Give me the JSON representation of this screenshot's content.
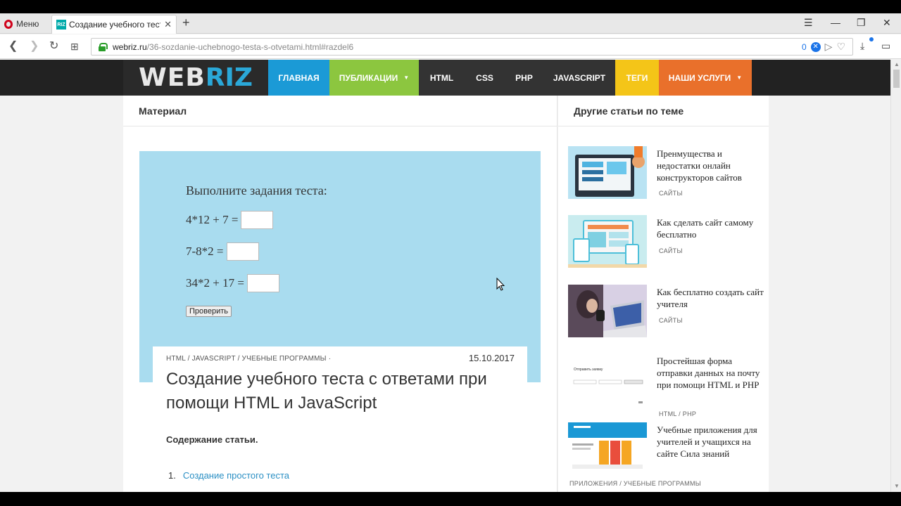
{
  "browser": {
    "menu_label": "Меню",
    "tab_title": "Создание учебного теста",
    "favicon_text": "RIZ",
    "url_host": "webriz.ru",
    "url_path": "/36-sozdanie-uchebnogo-testa-s-otvetami.html#razdel6",
    "adblock_count": "0"
  },
  "nav": {
    "logo_web": "WEB",
    "logo_riz": "RIZ",
    "items": [
      {
        "label": "ГЛАВНАЯ",
        "color": "#1b9ad6"
      },
      {
        "label": "ПУБЛИКАЦИИ",
        "color": "#8cc63f"
      },
      {
        "label": "HTML",
        "color": "#333333"
      },
      {
        "label": "CSS",
        "color": "#333333"
      },
      {
        "label": "PHP",
        "color": "#333333"
      },
      {
        "label": "JAVASCRIPT",
        "color": "#333333"
      },
      {
        "label": "ТЕГИ",
        "color": "#f4c518"
      },
      {
        "label": "НАШИ УСЛУГИ",
        "color": "#e9702b"
      }
    ]
  },
  "main": {
    "header": "Материал",
    "hero": {
      "title": "Выполните задания теста:",
      "questions": [
        "4*12 + 7 =",
        "7-8*2 =",
        "34*2 + 17 ="
      ],
      "check_button": "Проверить"
    },
    "article": {
      "cat1": "HTML",
      "cat2": "JAVASCRIPT",
      "cat3": "УЧЕБНЫЕ ПРОГРАММЫ",
      "date": "15.10.2017",
      "title": "Создание учебного теста с ответами при помощи HTML и JavaScript",
      "toc_label": "Содержание статьи.",
      "toc": [
        {
          "num": "1.",
          "label": "Создание простого теста"
        }
      ]
    }
  },
  "sidebar": {
    "header": "Другие статьи по теме",
    "items": [
      {
        "title": "Пренмущества и недостатки онлайн конструкторов сайтов",
        "category": "САЙТЫ"
      },
      {
        "title": "Как сделать сайт самому бесплатно",
        "category": "САЙТЫ"
      },
      {
        "title": "Как бесплатно создать сайт учителя",
        "category": "САЙТЫ"
      },
      {
        "title": "Простейшая форма отправки данных на почту при помощи HTML и PHP",
        "category": "HTML / PHP",
        "thumb_text": "Отправить заявку"
      },
      {
        "title": "Учебные приложения для учителей и учащихся на сайте Сила знаний",
        "category": "ПРИЛОЖЕНИЯ / УЧЕБНЫЕ ПРОГРАММЫ"
      }
    ]
  }
}
